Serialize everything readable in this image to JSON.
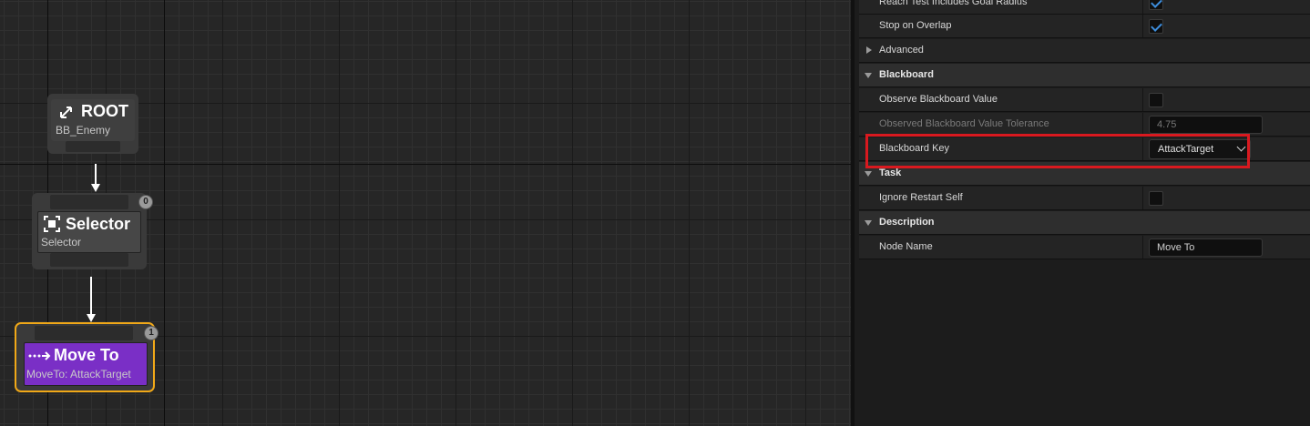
{
  "graph": {
    "root": {
      "title": "ROOT",
      "subtitle": "BB_Enemy",
      "icon": "tree-root-icon"
    },
    "selector": {
      "title": "Selector",
      "subtitle": "Selector",
      "badge": "0",
      "icon": "selector-icon"
    },
    "move_to": {
      "title": "Move To",
      "subtitle": "MoveTo: AttackTarget",
      "badge": "1",
      "icon": "move-arrow-icon"
    }
  },
  "details": {
    "rows": {
      "reach_test": {
        "label": "Reach Test Includes Goal Radius",
        "checked": true
      },
      "stop_on_overlap": {
        "label": "Stop on Overlap",
        "checked": true
      },
      "advanced": {
        "label": "Advanced"
      },
      "cat_blackboard": {
        "label": "Blackboard"
      },
      "observe_bb": {
        "label": "Observe Blackboard Value",
        "checked": false
      },
      "observed_tol": {
        "label": "Observed Blackboard Value Tolerance",
        "value": "4.75"
      },
      "bb_key": {
        "label": "Blackboard Key",
        "value": "AttackTarget"
      },
      "cat_task": {
        "label": "Task"
      },
      "ignore_restart": {
        "label": "Ignore Restart Self",
        "checked": false
      },
      "cat_description": {
        "label": "Description"
      },
      "node_name": {
        "label": "Node Name",
        "value": "Move To"
      }
    }
  },
  "colors": {
    "accent_check": "#3d8ddc",
    "move_to_node": "#7a2fc6",
    "selected_outline": "#f0a818",
    "highlight_box": "#d9191f"
  }
}
